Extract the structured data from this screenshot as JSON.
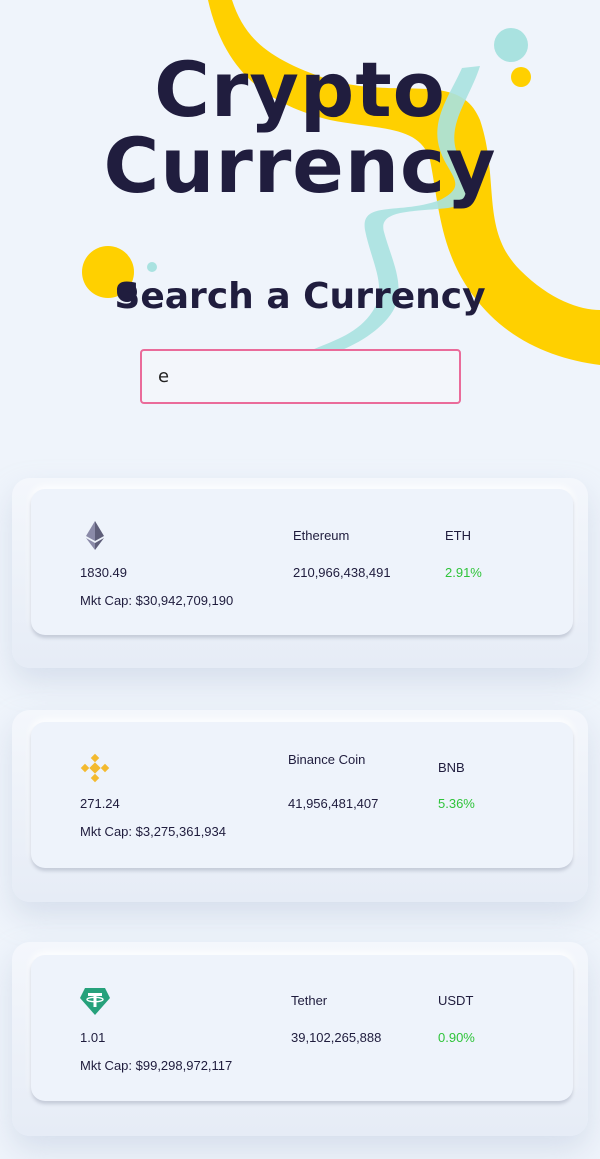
{
  "header": {
    "title_line1": "Crypto",
    "title_line2": "Currency",
    "subtitle": "Search a Currency"
  },
  "search": {
    "value": "e",
    "placeholder": ""
  },
  "colors": {
    "accent_yellow": "#ffd000",
    "accent_teal": "#a9e2e0",
    "text_dark": "#201d3e",
    "positive": "#2fc43a",
    "search_border": "#ea6b9a"
  },
  "coins": [
    {
      "icon": "ethereum-icon",
      "name": "Ethereum",
      "symbol": "ETH",
      "price": "1830.49",
      "volume": "210,966,438,491",
      "change": "2.91%",
      "market_cap": "Mkt Cap: $30,942,709,190"
    },
    {
      "icon": "binance-coin-icon",
      "name": "Binance Coin",
      "symbol": "BNB",
      "price": "271.24",
      "volume": "41,956,481,407",
      "change": "5.36%",
      "market_cap": "Mkt Cap: $3,275,361,934"
    },
    {
      "icon": "tether-icon",
      "name": "Tether",
      "symbol": "USDT",
      "price": "1.01",
      "volume": "39,102,265,888",
      "change": "0.90%",
      "market_cap": "Mkt Cap: $99,298,972,117"
    }
  ]
}
